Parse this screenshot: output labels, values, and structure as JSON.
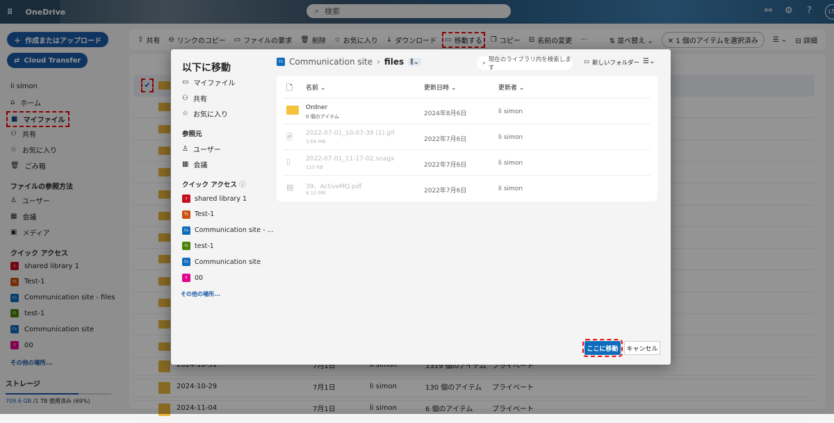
{
  "app": {
    "title": "OneDrive",
    "search_placeholder": "検索",
    "avatar": "LS"
  },
  "sidebar": {
    "create": "作成またはアップロード",
    "cloud": "Cloud Transfer",
    "user": "li simon",
    "items": [
      "ホーム",
      "マイファイル",
      "共有",
      "お気に入り",
      "ごみ箱"
    ],
    "browse_title": "ファイルの参照方法",
    "browse": [
      "ユーザー",
      "会議",
      "メディア"
    ],
    "quick_title": "クイック アクセス",
    "quick": [
      {
        "label": "shared library 1",
        "color": "#c50f1f",
        "abbr": "s"
      },
      {
        "label": "Test-1",
        "color": "#ca5010",
        "abbr": "T1"
      },
      {
        "label": "Communication site - files",
        "color": "#0f6cbd",
        "abbr": "Cs"
      },
      {
        "label": "test-1",
        "color": "#498205",
        "abbr": "t1"
      },
      {
        "label": "Communication site",
        "color": "#0f6cbd",
        "abbr": "Cs"
      },
      {
        "label": "00",
        "color": "#e3008c",
        "abbr": "0"
      }
    ],
    "more": "その他の場所...",
    "storage_title": "ストレージ",
    "storage_used": "709.6 GB",
    "storage_rest": " /1 TB 使用済み (69%)",
    "storage_pct": 69
  },
  "toolbar": {
    "items": [
      "共有",
      "リンクのコピー",
      "ファイルの要求",
      "削除",
      "お気に入り",
      "ダウンロード",
      "移動する",
      "コピー",
      "名前の変更",
      "···"
    ],
    "sort": "並べ替え",
    "selected": "1 個のアイテムを選択済み",
    "details": "詳細"
  },
  "list": {
    "rows": [
      {
        "name": "2024-10-31",
        "date": "7月1日",
        "by": "li simon",
        "size": "1319 個のアイテム",
        "share": "プライベート"
      },
      {
        "name": "2024-10-29",
        "date": "7月1日",
        "by": "li simon",
        "size": "130 個のアイテム",
        "share": "プライベート"
      },
      {
        "name": "2024-11-04",
        "date": "7月1日",
        "by": "li simon",
        "size": "6 個のアイテム",
        "share": "プライベート"
      }
    ]
  },
  "dialog": {
    "title": "以下に移動",
    "nav": [
      "マイファイル",
      "共有",
      "お気に入り"
    ],
    "source_title": "参照元",
    "source": [
      "ユーザー",
      "会議"
    ],
    "quick_title": "クイック アクセス",
    "quick": [
      {
        "label": "shared library 1",
        "color": "#c50f1f",
        "abbr": "s"
      },
      {
        "label": "Test-1",
        "color": "#ca5010",
        "abbr": "T1"
      },
      {
        "label": "Communication site - ...",
        "color": "#0f6cbd",
        "abbr": "Cs"
      },
      {
        "label": "test-1",
        "color": "#498205",
        "abbr": "t1"
      },
      {
        "label": "Communication site",
        "color": "#0f6cbd",
        "abbr": "Cs"
      },
      {
        "label": "00",
        "color": "#e3008c",
        "abbr": "0"
      }
    ],
    "more": "その他の場所...",
    "breadcrumb_site": "Communication site",
    "breadcrumb_current": "files",
    "search_placeholder": "現在のライブラリ内を検索します",
    "new_folder": "新しいフォルダー",
    "columns": [
      "名前",
      "更新日時",
      "更新者"
    ],
    "files": [
      {
        "name": "Ordner",
        "sub": "0 個のアイテム",
        "date": "2024年8月6日",
        "by": "li simon",
        "type": "folder"
      },
      {
        "name": "2022-07-01_10-07-39 (1).gif",
        "sub": "3.66 MB",
        "date": "2022年7月6日",
        "by": "li simon",
        "type": "image"
      },
      {
        "name": "2022-07-01_11-17-02.snagx",
        "sub": "110 KB",
        "date": "2022年7月6日",
        "by": "li simon",
        "type": "file"
      },
      {
        "name": "39、ActiveMQ.pdf",
        "sub": "8.10 MB",
        "date": "2022年7月6日",
        "by": "li simon",
        "type": "pdf"
      }
    ],
    "move_here": "ここに移動",
    "cancel": "キャンセル"
  }
}
